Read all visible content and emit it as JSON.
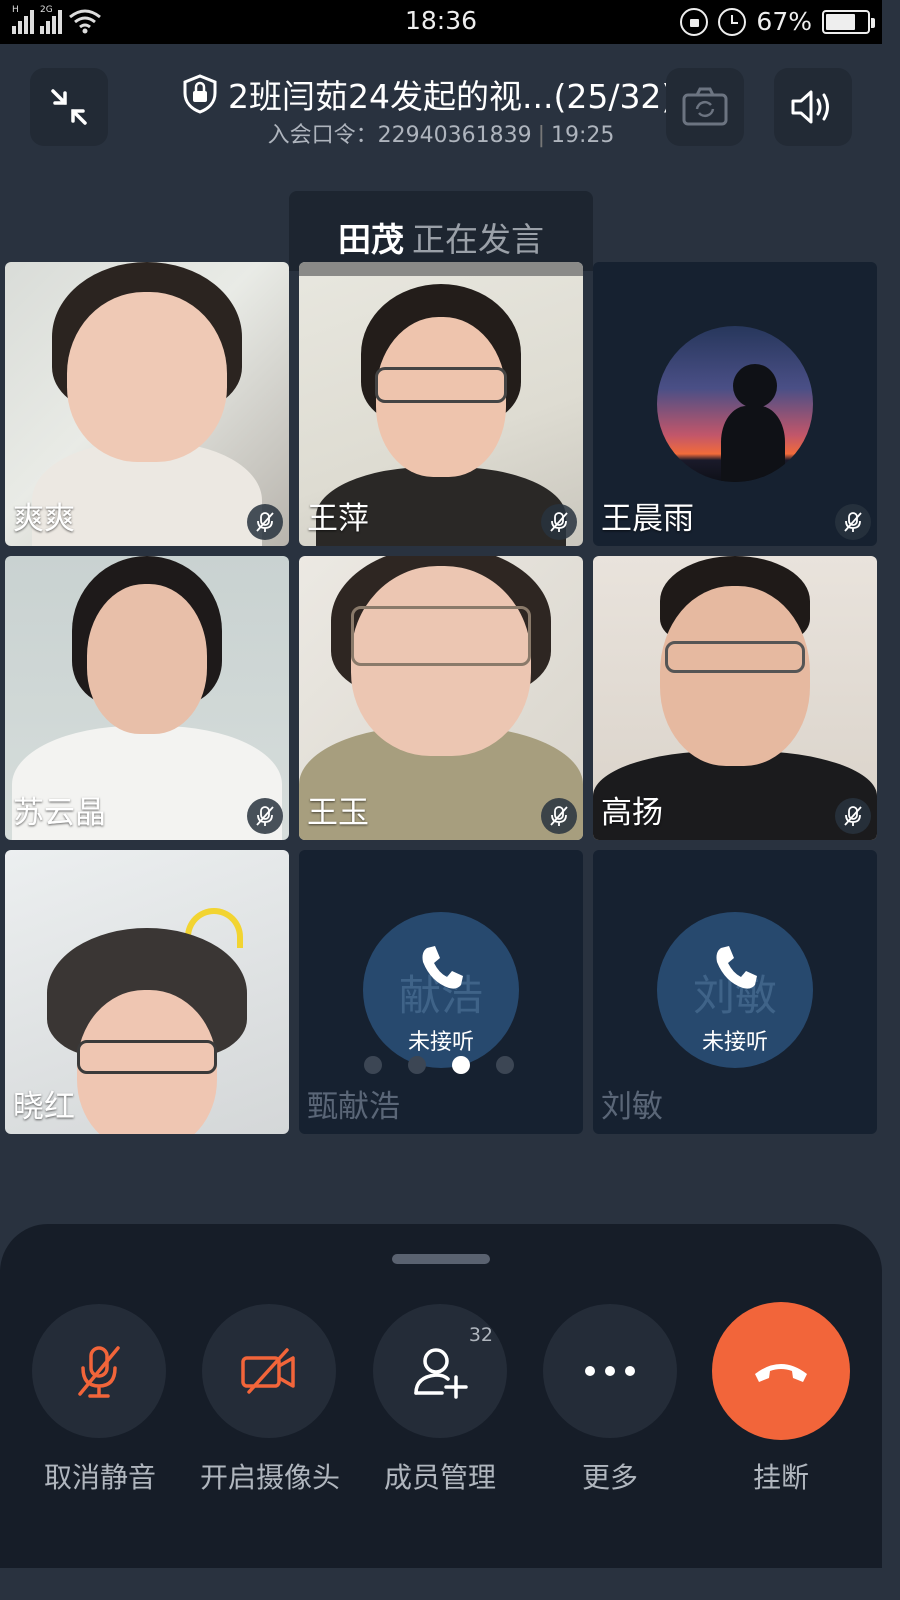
{
  "status_bar": {
    "sig1_tag": "H",
    "sig2_tag": "2G",
    "time": "18:36",
    "battery": "67%"
  },
  "header": {
    "title": "2班闫茹24发起的视...(25/32)",
    "meeting_code_label": "入会口令：",
    "meeting_code": "22940361839",
    "duration": "19:25"
  },
  "speaker": {
    "name": "田茂",
    "status": "正在发言"
  },
  "tiles": [
    {
      "name": "爽爽",
      "muted": true
    },
    {
      "name": "王萍",
      "muted": true
    },
    {
      "name": "王晨雨",
      "muted": true
    },
    {
      "name": "苏云晶",
      "muted": true
    },
    {
      "name": "王玉",
      "muted": true
    },
    {
      "name": "高扬",
      "muted": true
    },
    {
      "name": "晓红",
      "muted": false
    },
    {
      "name": "甄献浩",
      "avatar_text": "献浩",
      "call_status": "未接听"
    },
    {
      "name": "刘敏",
      "avatar_text": "刘敏",
      "call_status": "未接听"
    }
  ],
  "pager": {
    "pages": 4,
    "active": 3
  },
  "controls": {
    "unmute": "取消静音",
    "camera": "开启摄像头",
    "members": "成员管理",
    "members_count": "32",
    "more": "更多",
    "hangup": "挂断"
  },
  "colors": {
    "accent_orange": "#f2653a",
    "background": "#29323f",
    "panel": "#161d28"
  }
}
